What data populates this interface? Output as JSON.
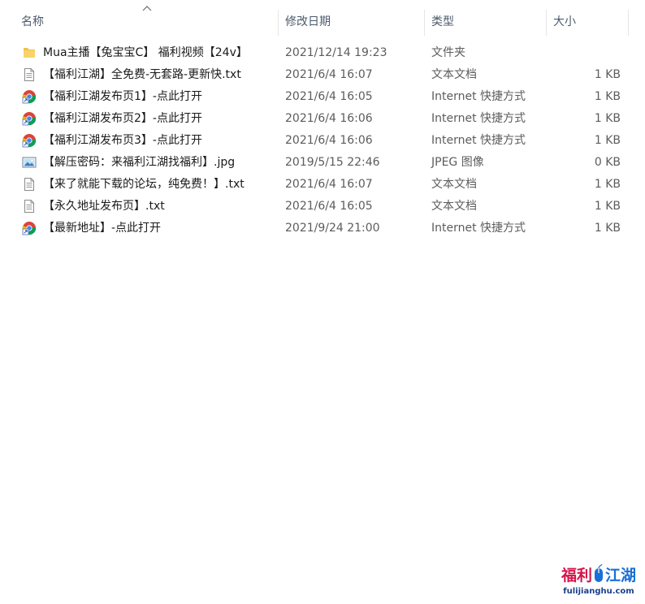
{
  "columns": {
    "name": "名称",
    "date": "修改日期",
    "type": "类型",
    "size": "大小"
  },
  "files": [
    {
      "icon": "folder-icon",
      "name": "Mua主播【兔宝宝C】 福利视频【24v】",
      "date": "2021/12/14 19:23",
      "type": "文件夹",
      "size": ""
    },
    {
      "icon": "text-file-icon",
      "name": "【福利江湖】全免费-无套路-更新快.txt",
      "date": "2021/6/4 16:07",
      "type": "文本文档",
      "size": "1 KB"
    },
    {
      "icon": "internet-shortcut-icon",
      "name": "【福利江湖发布页1】-点此打开",
      "date": "2021/6/4 16:05",
      "type": "Internet 快捷方式",
      "size": "1 KB"
    },
    {
      "icon": "internet-shortcut-icon",
      "name": "【福利江湖发布页2】-点此打开",
      "date": "2021/6/4 16:06",
      "type": "Internet 快捷方式",
      "size": "1 KB"
    },
    {
      "icon": "internet-shortcut-icon",
      "name": "【福利江湖发布页3】-点此打开",
      "date": "2021/6/4 16:06",
      "type": "Internet 快捷方式",
      "size": "1 KB"
    },
    {
      "icon": "image-file-icon",
      "name": "【解压密码：来福利江湖找福利】.jpg",
      "date": "2019/5/15 22:46",
      "type": "JPEG 图像",
      "size": "0 KB"
    },
    {
      "icon": "text-file-icon",
      "name": "【来了就能下载的论坛，纯免费！】.txt",
      "date": "2021/6/4 16:07",
      "type": "文本文档",
      "size": "1 KB"
    },
    {
      "icon": "text-file-icon",
      "name": "【永久地址发布页】.txt",
      "date": "2021/6/4 16:05",
      "type": "文本文档",
      "size": "1 KB"
    },
    {
      "icon": "internet-shortcut-icon",
      "name": "【最新地址】-点此打开",
      "date": "2021/9/24 21:00",
      "type": "Internet 快捷方式",
      "size": "1 KB"
    }
  ],
  "watermark": {
    "part1": "福利",
    "part2": "江湖",
    "url": "fulijianghu.com"
  },
  "colors": {
    "header_text": "#4c5a6b",
    "folder": "#f2c04a",
    "watermark_red": "#d4144a",
    "watermark_blue": "#1a6fd6"
  }
}
